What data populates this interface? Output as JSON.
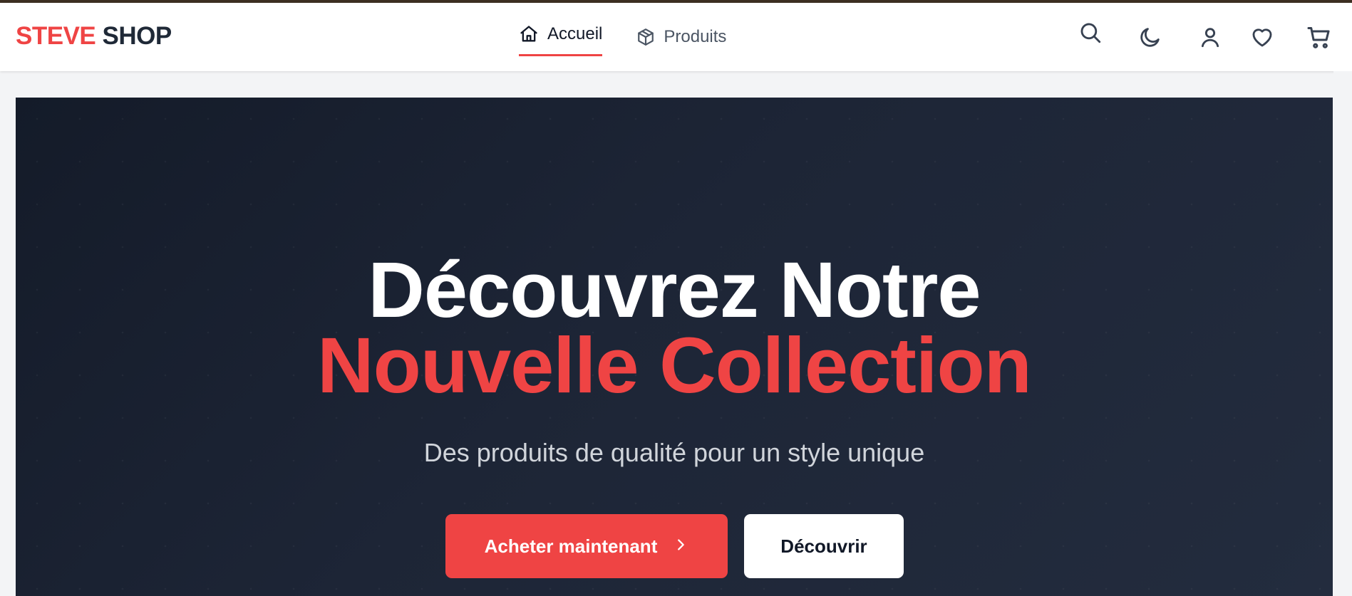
{
  "header": {
    "brand_part1": "STEVE",
    "brand_part2": "SHOP",
    "nav": [
      {
        "label": "Accueil",
        "icon": "home-icon",
        "active": true
      },
      {
        "label": "Produits",
        "icon": "box-icon",
        "active": false
      }
    ],
    "actions": [
      "search-icon",
      "moon-icon",
      "user-icon",
      "heart-icon",
      "cart-icon"
    ]
  },
  "hero": {
    "title_line1": "Découvrez Notre",
    "title_line2": "Nouvelle Collection",
    "subtitle": "Des produits de qualité pour un style unique",
    "primary_button": "Acheter maintenant",
    "secondary_button": "Découvrir"
  },
  "colors": {
    "accent": "#ef4444",
    "dark": "#1f2937",
    "hero_bg": "#1c2435"
  }
}
